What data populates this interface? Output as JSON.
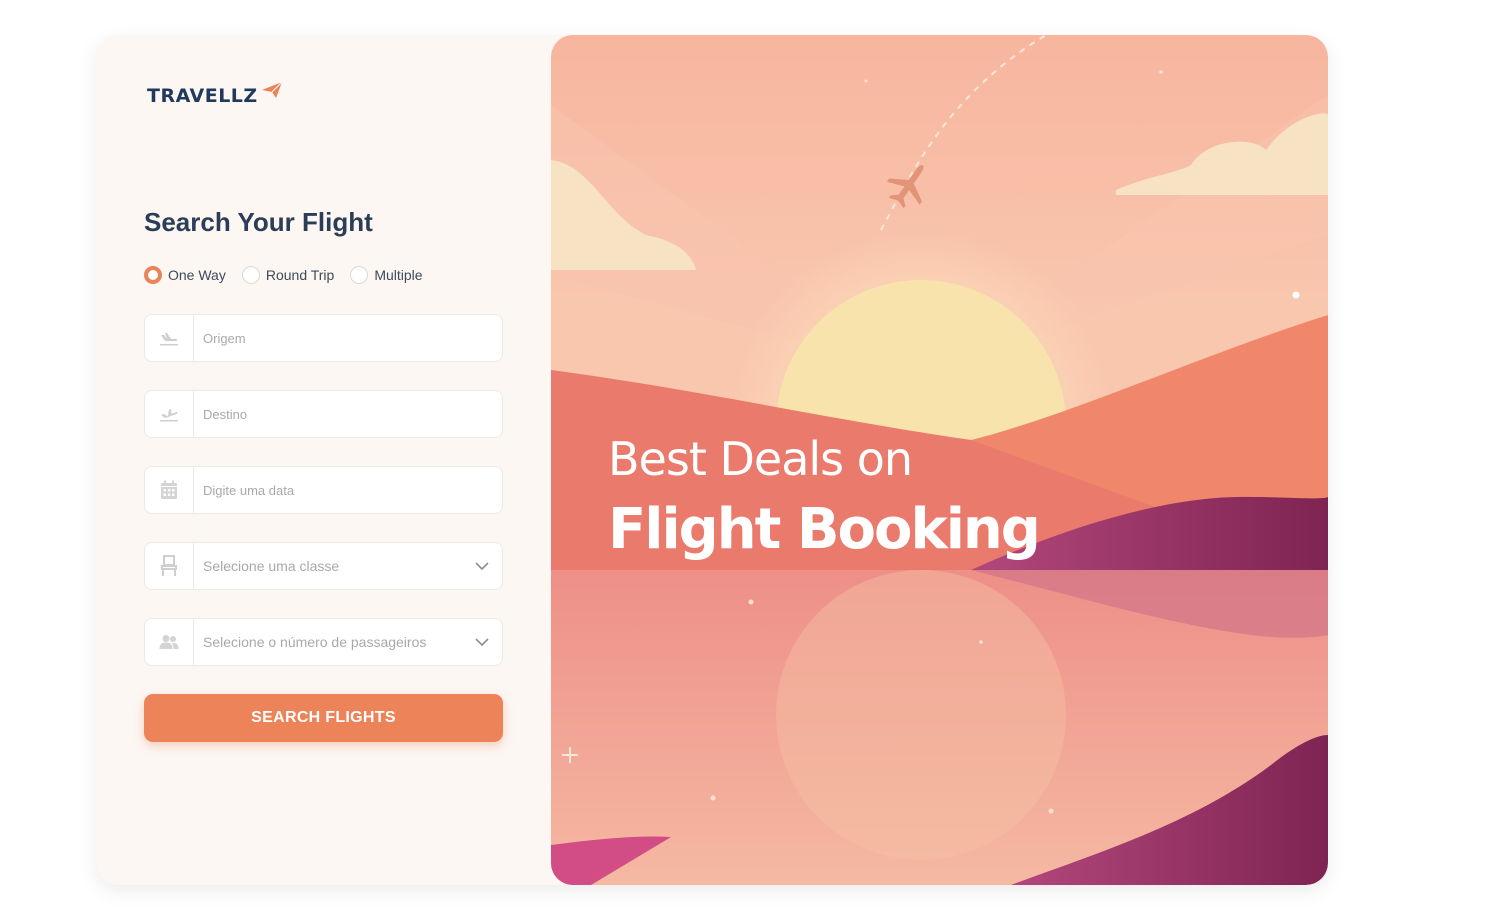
{
  "brand": {
    "name": "TRAVELLZ",
    "accent": "#ec8257",
    "dark": "#1f3a5c"
  },
  "form": {
    "title": "Search Your Flight",
    "trip_types": [
      {
        "label": "One Way",
        "checked": true
      },
      {
        "label": "Round Trip",
        "checked": false
      },
      {
        "label": "Multiple",
        "checked": false
      }
    ],
    "origin_placeholder": "Origem",
    "destination_placeholder": "Destino",
    "date_placeholder": "Digite uma data",
    "class_select": "Selecione uma classe",
    "passengers_select": "Selecione o número de passageiros",
    "search_button": "SEARCH FLIGHTS"
  },
  "hero": {
    "line1": "Best Deals on",
    "line2": "Flight Booking"
  }
}
